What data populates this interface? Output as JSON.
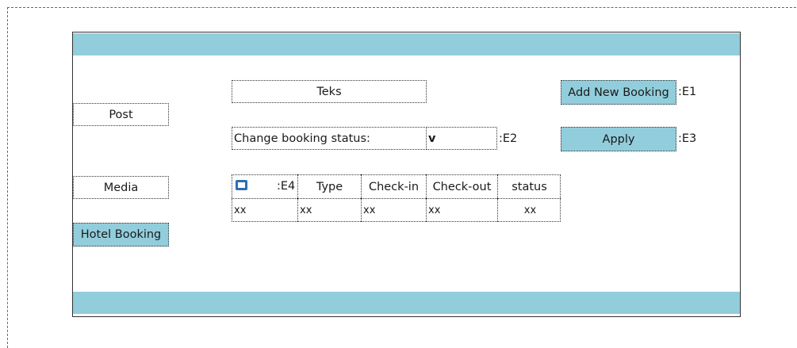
{
  "nav": {
    "post": "Post",
    "media": "Media",
    "hotel_booking": "Hotel Booking"
  },
  "form": {
    "text_field": "Teks",
    "status_label": "Change booking status:",
    "status_dropdown": "v",
    "status_tag": ":E2"
  },
  "actions": {
    "add_new": "Add New Booking",
    "add_new_tag": ":E1",
    "apply": "Apply",
    "apply_tag": ":E3"
  },
  "table": {
    "select_all_tag": ":E4",
    "headers": [
      "Type",
      "Check-in",
      "Check-out",
      "status"
    ],
    "rows": [
      [
        "xx",
        "xx",
        "xx",
        "xx",
        "xx"
      ]
    ]
  },
  "colors": {
    "accent": "#92cddc",
    "checkbox": "#2f6fb1"
  }
}
